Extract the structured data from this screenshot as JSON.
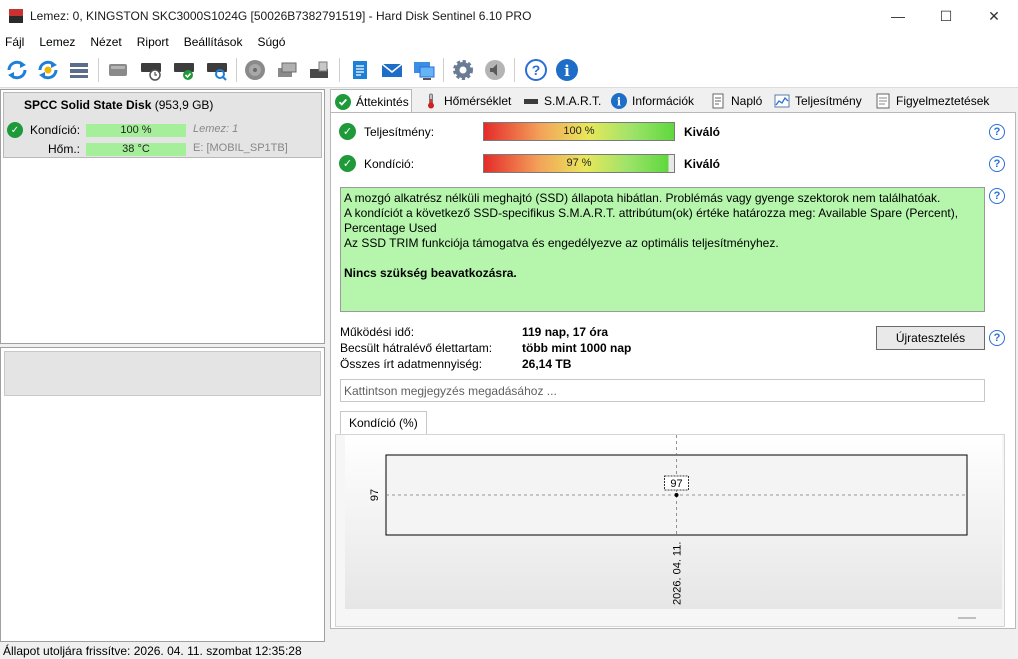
{
  "window": {
    "title": "Lemez: 0, KINGSTON SKC3000S1024G [50026B7382791519]  -  Hard Disk Sentinel 6.10 PRO"
  },
  "menu": [
    {
      "label": "Fájl"
    },
    {
      "label": "Lemez"
    },
    {
      "label": "Nézet"
    },
    {
      "label": "Riport"
    },
    {
      "label": "Beállítások"
    },
    {
      "label": "Súgó"
    }
  ],
  "toolbar_icons": [
    "refresh-icon",
    "refresh-all-icon",
    "disk-list-icon",
    "disk-icon",
    "disk-schedule-icon",
    "disk-ok-icon",
    "disk-search-icon",
    "surface-test-icon",
    "disk-export-icon",
    "disk-usb-icon",
    "report-icon",
    "email-icon",
    "network-icon",
    "settings-icon",
    "sound-icon",
    "help-icon",
    "info-icon"
  ],
  "left": {
    "disk_name": "SPCC Solid State Disk",
    "disk_size": "(953,9 GB)",
    "health_label": "Kondíció:",
    "health_value": "100 %",
    "health_right": "Lemez: 1",
    "temp_label": "Hőm.:",
    "temp_value": "38 °C",
    "temp_right": "E: [MOBIL_SP1TB]"
  },
  "tabs": [
    {
      "label": "Áttekintés",
      "icon": "check-icon"
    },
    {
      "label": "Hőmérséklet",
      "icon": "thermometer-icon"
    },
    {
      "label": "S.M.A.R.T.",
      "icon": "smart-icon"
    },
    {
      "label": "Információk",
      "icon": "info-icon"
    },
    {
      "label": "Napló",
      "icon": "log-icon"
    },
    {
      "label": "Teljesítmény",
      "icon": "performance-icon"
    },
    {
      "label": "Figyelmeztetések",
      "icon": "alerts-icon"
    }
  ],
  "overview": {
    "performance_label": "Teljesítmény:",
    "performance_value": "100 %",
    "performance_fraction": 1.0,
    "performance_rating": "Kiváló",
    "health_label": "Kondíció:",
    "health_value": "97 %",
    "health_fraction": 0.97,
    "health_rating": "Kiváló",
    "info_lines": [
      "A mozgó alkatrész nélküli meghajtó (SSD) állapota hibátlan. Problémás vagy gyenge szektorok nem találhatóak.",
      "A kondíciót a következő SSD-specifikus S.M.A.R.T. attribútum(ok) értéke határozza meg:  Available Spare (Percent), Percentage Used",
      "Az SSD TRIM funkciója támogatva és engedélyezve az optimális teljesítményhez."
    ],
    "info_action": "Nincs szükség beavatkozásra.",
    "uptime_label": "Működési idő:",
    "uptime_value": "119 nap, 17 óra",
    "lifetime_label": "Becsült hátralévő élettartam:",
    "lifetime_value": "több mint 1000 nap",
    "written_label": "Összes írt adatmennyiség:",
    "written_value": "26,14 TB",
    "retest_button": "Újratesztelés",
    "note_placeholder": "Kattintson megjegyzés megadásához ...",
    "chart_tab": "Kondíció  (%)",
    "accent_green": "#b5f5ac"
  },
  "chart_data": {
    "type": "line",
    "x": [
      "2026. 04. 11."
    ],
    "series": [
      {
        "values": [
          97
        ]
      }
    ],
    "ytick_labels": [
      "97"
    ],
    "xtick_labels": [
      "2026. 04. 11."
    ],
    "data_labels": [
      "97"
    ],
    "grid": true
  },
  "status": {
    "text": "Állapot utoljára frissítve: 2026. 04. 11. szombat 12:35:28"
  }
}
